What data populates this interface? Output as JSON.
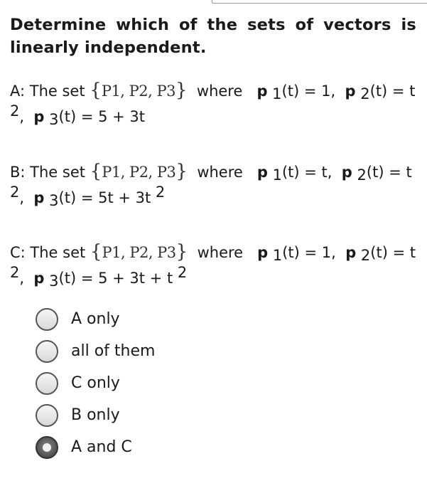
{
  "question": {
    "title_line1_words": [
      "Determine",
      "which",
      "of",
      "the",
      "sets",
      "of",
      "vectors",
      "is"
    ],
    "title_line2": "linearly independent."
  },
  "options": [
    {
      "prefix": "A: The set",
      "set_open": "{",
      "set_items": "P1, P2, P3",
      "set_close": "}",
      "where": "where",
      "p1_label": "p",
      "p1_sub": "1",
      "p1_def": "(t) = 1,",
      "p2_label": "p",
      "p2_sub": "2",
      "p2_def": "(t) = t",
      "p2_exp": "2",
      "comma": ",",
      "p3_label": "p",
      "p3_sub": "3",
      "p3_def": "(t) = 5 + 3t",
      "p3_exp": ""
    },
    {
      "prefix": "B: The set",
      "set_open": "{",
      "set_items": "P1, P2, P3",
      "set_close": "}",
      "where": "where",
      "p1_label": "p",
      "p1_sub": "1",
      "p1_def": "(t) = t,",
      "p2_label": "p",
      "p2_sub": "2",
      "p2_def": "(t) = t",
      "p2_exp": "2",
      "comma": ",",
      "p3_label": "p",
      "p3_sub": "3",
      "p3_def": "(t) = 5t + 3t",
      "p3_exp": "2"
    },
    {
      "prefix": "C: The set",
      "set_open": "{",
      "set_items": "P1, P2, P3",
      "set_close": "}",
      "where": "where",
      "p1_label": "p",
      "p1_sub": "1",
      "p1_def": "(t) = 1,",
      "p2_label": "p",
      "p2_sub": "2",
      "p2_def": "(t) = t",
      "p2_exp": "2",
      "comma": ",",
      "p3_label": "p",
      "p3_sub": "3",
      "p3_def": "(t) = 5 + 3t + t",
      "p3_exp": "2"
    }
  ],
  "answers": [
    {
      "label": "A only",
      "selected": false
    },
    {
      "label": "all of them",
      "selected": false
    },
    {
      "label": "C only",
      "selected": false
    },
    {
      "label": "B only",
      "selected": false
    },
    {
      "label": "A and C",
      "selected": true
    }
  ]
}
